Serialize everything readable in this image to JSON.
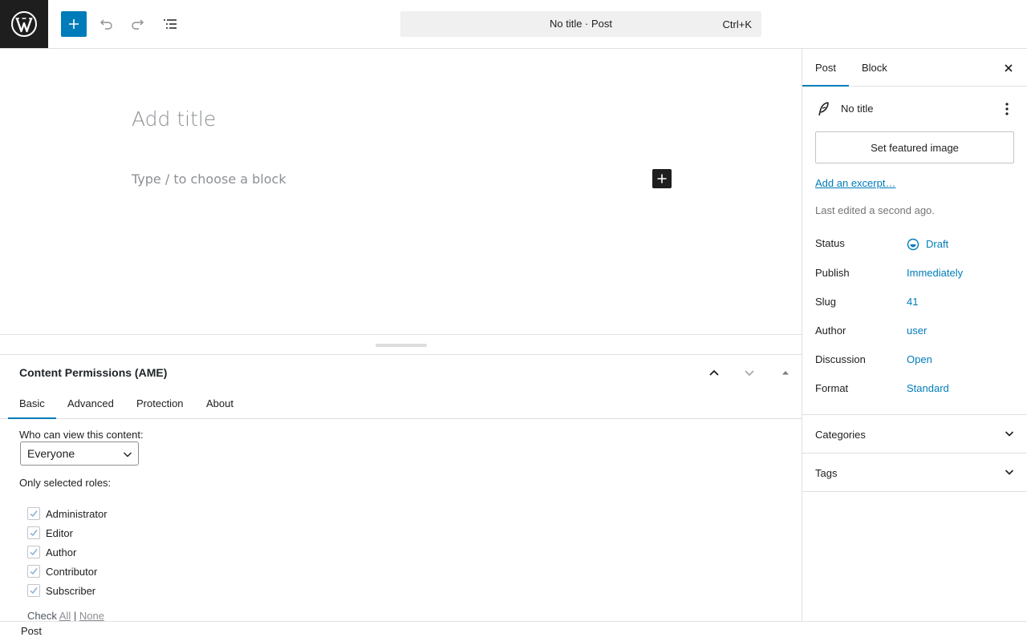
{
  "header": {
    "command_title": "No title · Post",
    "command_shortcut": "Ctrl+K",
    "icons": [
      "wordpress-logo",
      "plus-icon",
      "undo-icon",
      "redo-icon",
      "document-overview-icon"
    ]
  },
  "editor": {
    "title_placeholder": "Add title",
    "block_placeholder": "Type / to choose a block"
  },
  "metabox": {
    "title": "Content Permissions (AME)",
    "tabs": [
      "Basic",
      "Advanced",
      "Protection",
      "About"
    ],
    "active_tab": "Basic",
    "view_label": "Who can view this content:",
    "view_select": "Everyone",
    "roles_label": "Only selected roles:",
    "roles": [
      "Administrator",
      "Editor",
      "Author",
      "Contributor",
      "Subscriber"
    ],
    "check_label": "Check",
    "check_all": "All",
    "separator": "|",
    "check_none": "None"
  },
  "footer": {
    "breadcrumb": "Post"
  },
  "sidebar": {
    "tabs": [
      "Post",
      "Block"
    ],
    "active_tab": "Post",
    "post_title": "No title",
    "featured_image_button": "Set featured image",
    "excerpt_link": "Add an excerpt…",
    "last_edited": "Last edited a second ago.",
    "properties": [
      {
        "key": "Status",
        "value": "Draft"
      },
      {
        "key": "Publish",
        "value": "Immediately"
      },
      {
        "key": "Slug",
        "value": "41"
      },
      {
        "key": "Author",
        "value": "user"
      },
      {
        "key": "Discussion",
        "value": "Open"
      },
      {
        "key": "Format",
        "value": "Standard"
      }
    ],
    "panels": [
      "Categories",
      "Tags"
    ]
  },
  "colors": {
    "accent": "#007cba",
    "dark": "#1e1e1e",
    "placeholder": "#8c8f94"
  }
}
